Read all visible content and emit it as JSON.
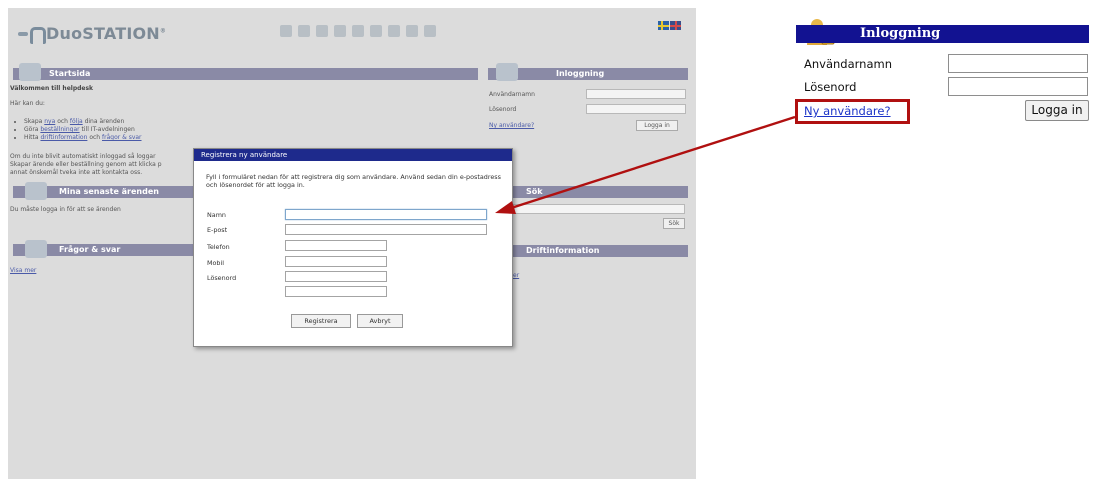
{
  "app": {
    "logo_text": "DuoSTATION",
    "logo_tm": "®"
  },
  "sections": {
    "startsida": "Startsida",
    "welcome_title": "Välkommen till helpdesk",
    "here_you_can": "Här kan du:",
    "bullets": [
      {
        "pre": "Skapa ",
        "link1": "nya",
        "mid": " och ",
        "link2": "följa",
        "post": " dina ärenden"
      },
      {
        "pre": "Göra ",
        "link1": "beställningar",
        "mid": " till IT-avdelningen",
        "link2": "",
        "post": ""
      },
      {
        "pre": "Hitta ",
        "link1": "driftinformation",
        "mid": " och ",
        "link2": "frågor & svar",
        "post": ""
      }
    ],
    "auto_login_lines": [
      "Om du inte blivit automatiskt inloggad så loggar",
      "Skapar ärende eller beställning genom att klicka p",
      "annat önskemål tveka inte att kontakta oss."
    ],
    "recent": "Mina senaste ärenden",
    "recent_note": "Du måste logga in för att se ärenden",
    "faq": "Frågor & svar",
    "show_more": "Visa mer",
    "login_small": "Inloggning",
    "username_small": "Användarnamn",
    "password_small": "Lösenord",
    "new_user_small": "Ny användare?",
    "login_btn_small": "Logga in",
    "search": "Sök",
    "search_btn": "Sök",
    "driftinfo": "Driftinformation",
    "driftinfo_more": "er"
  },
  "modal": {
    "title": "Registrera ny användare",
    "intro": "Fyll i formuläret nedan för att registrera dig som användare. Använd sedan din e-postadress och lösenordet för att logga in.",
    "fields": [
      "Namn",
      "E-post",
      "Telefon",
      "Mobil",
      "Lösenord"
    ],
    "register_btn": "Registrera",
    "cancel_btn": "Avbryt"
  },
  "zoom": {
    "title": "Inloggning",
    "username_label": "Användarnamn",
    "password_label": "Lösenord",
    "new_user_link": "Ny användare?",
    "login_button": "Logga in"
  },
  "colors": {
    "accent_bar": "#8a8aa6",
    "modal_header": "#1e2a8c",
    "login_header": "#121291",
    "highlight": "#b01010",
    "link": "#1c34c8"
  }
}
